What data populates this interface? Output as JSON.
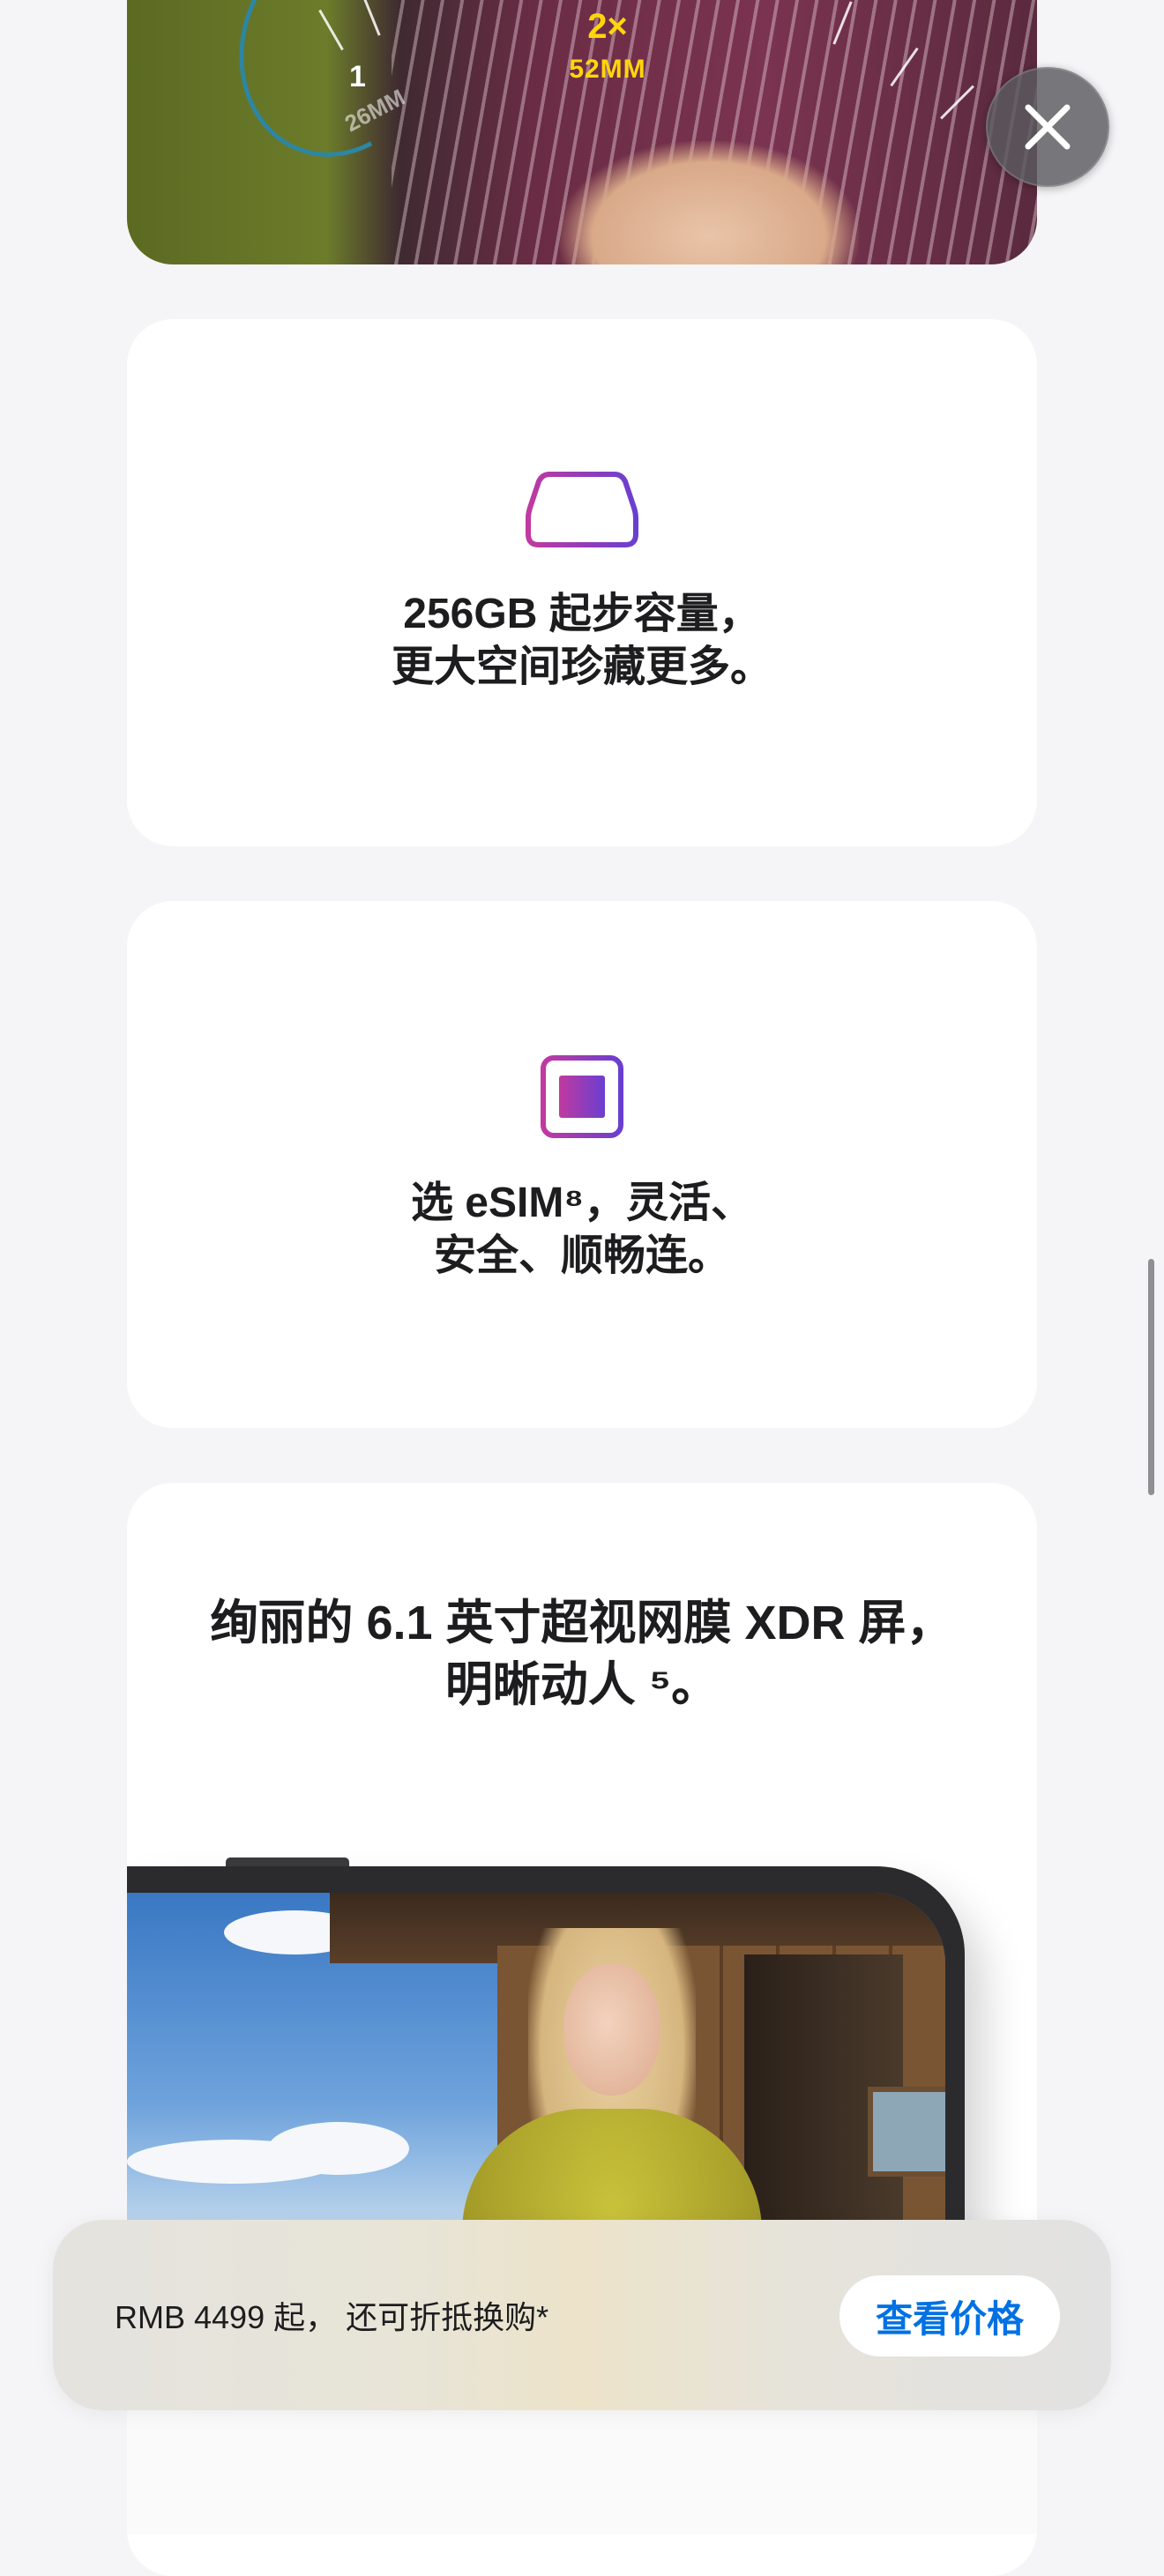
{
  "top_photo": {
    "zoom_2x": "2×",
    "zoom_52mm": "52MM",
    "zoom_1x": "1",
    "zoom_26mm": "26MM"
  },
  "close_button": {
    "icon": "close-icon"
  },
  "features": [
    {
      "icon": "storage-drive-icon",
      "line1": "256GB 起步容量，",
      "line2": "更大空间珍藏更多。"
    },
    {
      "icon": "esim-chip-icon",
      "line1": "选 eSIM⁸，灵活、",
      "line2": "安全、顺畅连。"
    },
    {
      "line1": "绚丽的 6.1 英寸超视网膜 XDR 屏，",
      "line2": "明晰动人 ⁵。"
    }
  ],
  "price_bar": {
    "text": "RMB 4499 起， 还可折抵换购*",
    "button_label": "查看价格"
  },
  "colors": {
    "accent_blue": "#0071e3",
    "zoom_yellow": "#ffd60a",
    "icon_gradient_start": "#c03aa0",
    "icon_gradient_end": "#6a3fd0"
  }
}
